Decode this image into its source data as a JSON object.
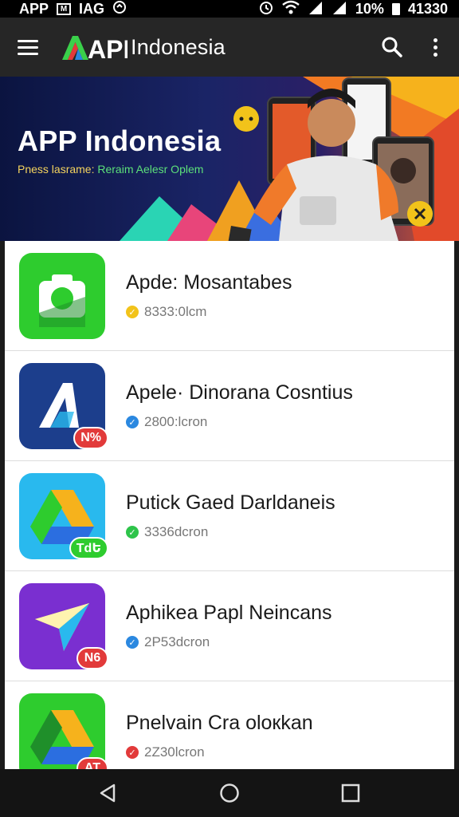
{
  "status_bar": {
    "left": [
      "APP",
      "IAG"
    ],
    "battery_text": "10%",
    "time": "41330"
  },
  "app_bar": {
    "logo_text": "APK",
    "brand_text": "Indonesia"
  },
  "banner": {
    "title": "APP Indonesia",
    "subtitle_part1": "Pness lasrame:",
    "subtitle_part2": "Reraim Aelesr Oplem"
  },
  "apps": [
    {
      "name": "Apde: Mosantabes",
      "meta": "8333:0lcm",
      "check_color": "#f2c31a",
      "icon_bg": "#2ecc2e",
      "badge": ""
    },
    {
      "name": "Apele· Dinorana Cosntius",
      "meta": "2800:lcron",
      "check_color": "#2b88e0",
      "icon_bg": "#1c3e8c",
      "badge": "N%",
      "badge_color": "#e23a3a"
    },
    {
      "name": "Putick Gaed Darldaneis",
      "meta": "3336dcron",
      "check_color": "#2ec44a",
      "icon_bg": "#29b9ee",
      "badge": "TdԵ",
      "badge_color": "#2ecc2e"
    },
    {
      "name": "Aphikea Papl Neincans",
      "meta": "2P53dcron",
      "check_color": "#2b88e0",
      "icon_bg": "#7a2fd0",
      "badge": "N6",
      "badge_color": "#e23a3a"
    },
    {
      "name": "Pnelvain Cra oloкkan",
      "meta": "2Z30lcron",
      "check_color": "#e23a3a",
      "icon_bg": "#2ecc2e",
      "badge": "AT",
      "badge_color": "#e23a3a"
    }
  ]
}
